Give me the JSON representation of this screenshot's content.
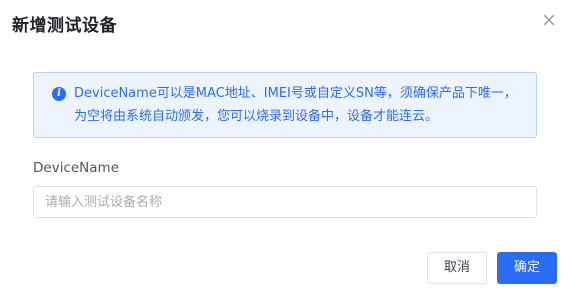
{
  "dialog": {
    "title": "新增测试设备",
    "close_icon": "close-icon"
  },
  "alert": {
    "icon": "info-icon",
    "icon_glyph": "i",
    "message": "DeviceName可以是MAC地址、IMEI号或自定义SN等，须确保产品下唯一，为空将由系统自动颁发，您可以烧录到设备中，设备才能连云。",
    "color": "#2a6cf6",
    "background": "#edf4ff"
  },
  "form": {
    "device_name_label": "DeviceName",
    "device_name_value": "",
    "device_name_placeholder": "请输入测试设备名称"
  },
  "footer": {
    "cancel_label": "取消",
    "confirm_label": "确定",
    "primary_color": "#2a6cf6"
  }
}
